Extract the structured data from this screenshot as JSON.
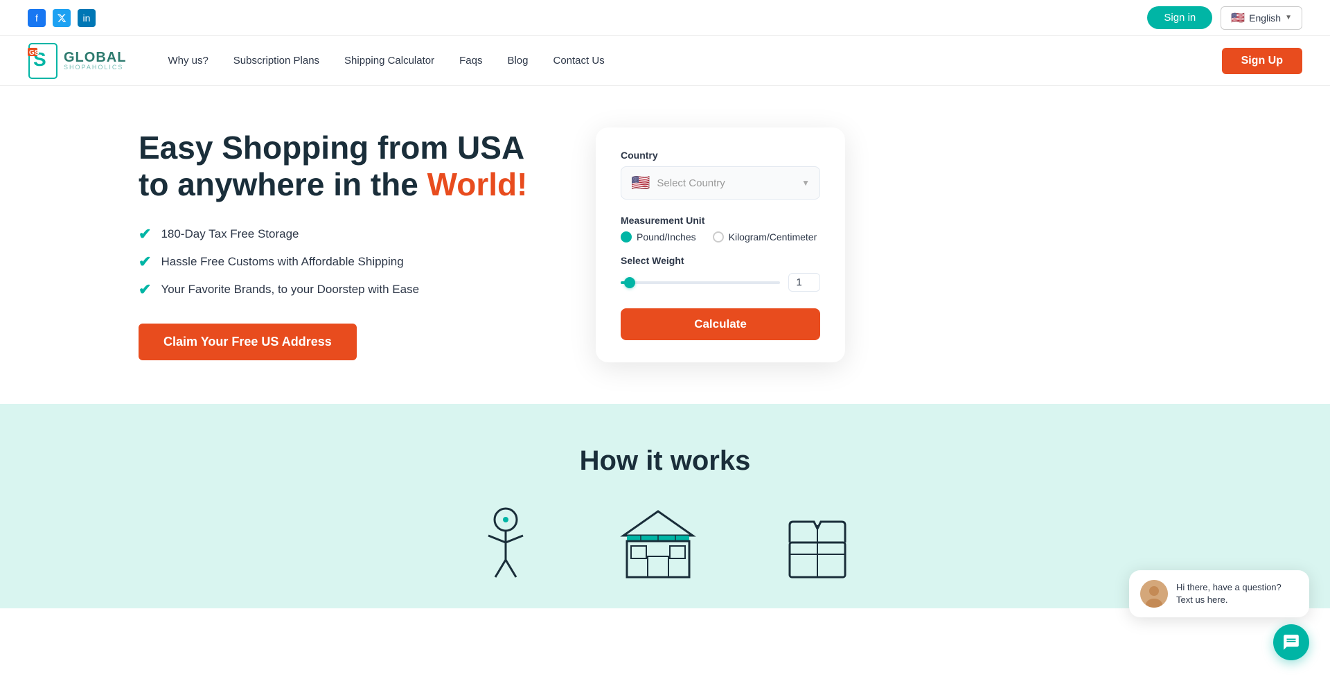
{
  "topbar": {
    "social": [
      {
        "name": "facebook",
        "label": "f",
        "class": "fb"
      },
      {
        "name": "twitter",
        "label": "𝕏",
        "class": "tw"
      },
      {
        "name": "linkedin",
        "label": "in",
        "class": "li"
      }
    ],
    "signin_label": "Sign in",
    "lang_label": "English",
    "lang_flag": "🇺🇸"
  },
  "nav": {
    "logo_global": "GLOBAL",
    "logo_sub": "SHOPAHOLICS",
    "links": [
      {
        "label": "Why us?",
        "name": "why-us"
      },
      {
        "label": "Subscription Plans",
        "name": "subscription-plans"
      },
      {
        "label": "Shipping Calculator",
        "name": "shipping-calculator"
      },
      {
        "label": "Faqs",
        "name": "faqs"
      },
      {
        "label": "Blog",
        "name": "blog"
      },
      {
        "label": "Contact Us",
        "name": "contact-us"
      }
    ],
    "signup_label": "Sign Up"
  },
  "hero": {
    "title_line1": "Easy Shopping from USA",
    "title_line2": "to anywhere in the",
    "title_highlight": "World!",
    "features": [
      "180-Day Tax Free Storage",
      "Hassle Free Customs with Affordable Shipping",
      "Your Favorite Brands, to your Doorstep with Ease"
    ],
    "cta_label": "Claim Your Free US Address"
  },
  "calculator": {
    "country_label": "Country",
    "country_placeholder": "Select Country",
    "measurement_label": "Measurement Unit",
    "option_pounds": "Pound/Inches",
    "option_kg": "Kilogram/Centimeter",
    "weight_label": "Select Weight",
    "weight_value": "1",
    "calc_btn_label": "Calculate"
  },
  "how": {
    "title": "How it works"
  },
  "chat": {
    "text": "Hi there, have a question? Text us here."
  }
}
